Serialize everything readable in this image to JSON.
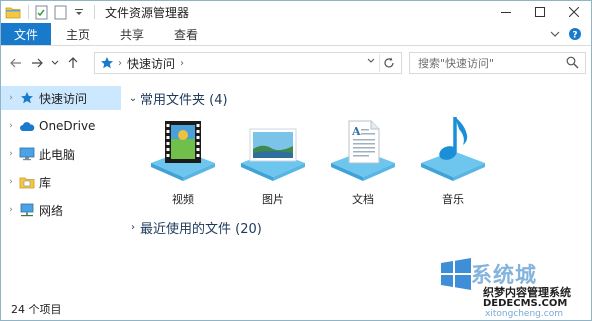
{
  "window": {
    "title": "文件资源管理器"
  },
  "ribbon": {
    "tabs": [
      "文件",
      "主页",
      "共享",
      "查看"
    ]
  },
  "address": {
    "crumb": "快速访问",
    "search_placeholder": "搜索\"快速访问\""
  },
  "nav": {
    "items": [
      {
        "label": "快速访问",
        "icon": "star-icon",
        "selected": true
      },
      {
        "label": "OneDrive",
        "icon": "cloud-icon",
        "selected": false
      },
      {
        "label": "此电脑",
        "icon": "computer-icon",
        "selected": false
      },
      {
        "label": "库",
        "icon": "library-icon",
        "selected": false
      },
      {
        "label": "网络",
        "icon": "network-icon",
        "selected": false
      }
    ]
  },
  "content": {
    "frequent_header": "常用文件夹 (4)",
    "recent_header": "最近使用的文件 (20)",
    "folders": [
      {
        "label": "视频",
        "icon": "video-folder-icon"
      },
      {
        "label": "图片",
        "icon": "pictures-folder-icon"
      },
      {
        "label": "文档",
        "icon": "documents-folder-icon"
      },
      {
        "label": "音乐",
        "icon": "music-folder-icon"
      }
    ]
  },
  "status": {
    "count": "24 个项目"
  },
  "watermark": {
    "brand": "系统城",
    "line1": "织梦内容管理系统",
    "line2": "DEDECMS.COM",
    "line3": "xitongcheng.com"
  },
  "colors": {
    "accent": "#1979ca",
    "selected_bg": "#cce8ff",
    "group_header": "#1e395b"
  }
}
